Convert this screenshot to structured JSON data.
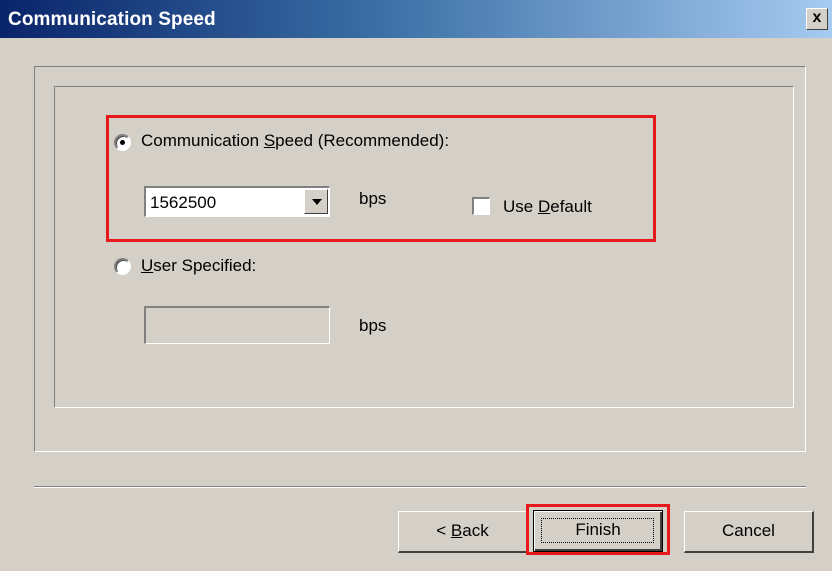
{
  "window": {
    "title": "Communication Speed",
    "close_glyph": "x"
  },
  "options": {
    "recommended": {
      "label_pre": "Communication ",
      "label_accel": "S",
      "label_post": "peed (Recommended):",
      "selected": true,
      "value": "1562500",
      "unit": "bps",
      "use_default": {
        "label_pre": "Use ",
        "label_accel": "D",
        "label_post": "efault",
        "checked": false
      }
    },
    "user_specified": {
      "label_accel": "U",
      "label_post": "ser Specified:",
      "selected": false,
      "value": "",
      "unit": "bps"
    }
  },
  "buttons": {
    "back": {
      "label_pre": "< ",
      "label_accel": "B",
      "label_post": "ack"
    },
    "finish": {
      "label": "Finish"
    },
    "cancel": {
      "label": "Cancel"
    }
  },
  "colors": {
    "highlight": "#e8181c",
    "title_bar_start": "#0a246a",
    "title_bar_end": "#a6caf0",
    "dialog_face": "#d4d0c8"
  }
}
